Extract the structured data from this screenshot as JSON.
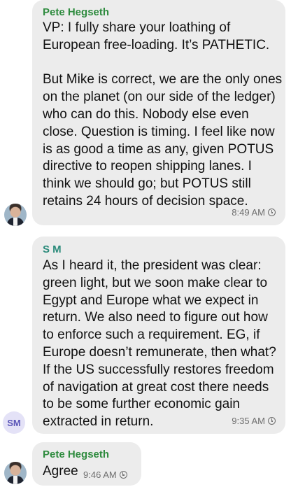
{
  "colors": {
    "bubble_bg": "#ececec",
    "pete_name": "#2e8b3e",
    "sm_name": "#2a8a7a",
    "sm_avatar_bg": "#e4e2f7",
    "sm_avatar_text": "#5b56b8"
  },
  "messages": [
    {
      "sender": "Pete Hegseth",
      "text": "VP: I fully share your loathing of\nEuropean free-loading. It’s PATHETIC.\n\nBut Mike is correct, we are the only ones\non the planet (on our side of the ledger)\nwho can do this. Nobody else even\nclose. Question is timing. I feel like now\nis as good a time as any, given POTUS\ndirective to reopen shipping lanes. I\nthink we should go; but POTUS still\nretains 24 hours of decision space.",
      "time": "8:49 AM",
      "avatar": "profile-photo"
    },
    {
      "sender": "S M",
      "text": "As I heard it, the president was clear:\ngreen light, but we soon make clear to\nEgypt and Europe what we expect in\nreturn. We also need to figure out how\nto enforce such a requirement. EG, if\nEurope doesn’t remunerate, then what?\nIf the US successfully restores freedom\nof navigation at great cost there needs\nto be some further economic gain\nextracted in return.",
      "time": "9:35 AM",
      "avatar_initials": "SM"
    },
    {
      "sender": "Pete Hegseth",
      "text": "Agree",
      "time": "9:46 AM",
      "avatar": "profile-photo"
    }
  ]
}
